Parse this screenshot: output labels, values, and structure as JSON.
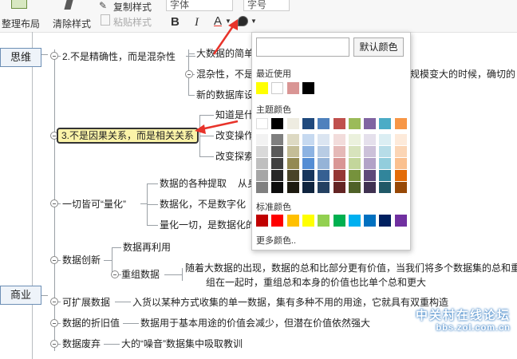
{
  "toolbar": {
    "arrange_label": "整理布局",
    "clear_label": "清除样式",
    "copy_style_label": "复制样式",
    "paste_style_label": "粘贴样式",
    "font_value": "字体",
    "font_size_value": "字号",
    "bold": "B",
    "italic": "I",
    "font_color": "A"
  },
  "mindmap": {
    "cat_thinking": "思维",
    "cat_business": "商业",
    "n_precision": "2.不是精确性，而是混杂性",
    "n_big_simple": "大数据的简单",
    "n_mixed": "混杂性，不是",
    "n_mixed_right": "规模变大的时候，确切的",
    "n_new_db": "新的数据库设",
    "n_causal": "3.不是因果关系，而是相关关系",
    "n_know": "知道是什",
    "n_change_op": "改变操作",
    "n_change_explore": "改变探索",
    "n_quantify": "一切皆可“量化”",
    "n_extract": "数据的各种提取",
    "n_extract_right": "从身",
    "n_datafy": "数据化，不是数字化",
    "n_quantify_all": "量化一切，是数据化的",
    "n_innovation": "数据创新",
    "n_reuse": "数据再利用",
    "n_recombine": "重组数据",
    "n_recombine_desc1": "随着大数据的出现，数据的总和比部分更有价值，当我们将多个数据集的总和重",
    "n_recombine_desc2": "组在一起时，重组总和本身的价值也比单个总和更大",
    "n_extensible": "可扩展数据",
    "n_extensible_desc": "入货以某种方式收集的单一数据，集有多种不用的用途，它就具有双重构造",
    "n_depreciation": "数据的折旧值",
    "n_depreciation_desc": "数据用于基本用途的价值会减少，但潜在价值依然强大",
    "n_waste": "数据废弃",
    "n_waste_desc": "大的“噪音”数据集中吸取教训"
  },
  "color_picker": {
    "hex_value": "",
    "default_button": "默认颜色",
    "recent_label": "最近使用",
    "theme_label": "主题颜色",
    "standard_label": "标准颜色",
    "more_colors": "更多颜色..",
    "recent_colors": [
      "#ffff00",
      "#ffffff",
      "#d99594",
      "#000000"
    ],
    "theme_top": [
      "#ffffff",
      "#000000",
      "#eeece1",
      "#1f497d",
      "#4f81bd",
      "#c0504d",
      "#9bbb59",
      "#8064a2",
      "#4bacc6",
      "#f79646"
    ],
    "theme_columns": [
      [
        "#f2f2f2",
        "#d9d9d9",
        "#bfbfbf",
        "#a6a6a6",
        "#808080"
      ],
      [
        "#7f7f7f",
        "#595959",
        "#3f3f3f",
        "#262626",
        "#0d0d0d"
      ],
      [
        "#ddd9c3",
        "#c4bd97",
        "#938953",
        "#494429",
        "#1d1b10"
      ],
      [
        "#c6d9f0",
        "#8db3e2",
        "#548dd4",
        "#17365d",
        "#0f243e"
      ],
      [
        "#dbe5f1",
        "#b8cce4",
        "#95b3d7",
        "#366092",
        "#244061"
      ],
      [
        "#f2dcdb",
        "#e5b9b7",
        "#d99694",
        "#953734",
        "#632423"
      ],
      [
        "#ebf1dd",
        "#d7e3bc",
        "#c3d69b",
        "#76923c",
        "#4f6128"
      ],
      [
        "#e5e0ec",
        "#ccc1d9",
        "#b2a2c7",
        "#5f497a",
        "#3f3151"
      ],
      [
        "#dbeef3",
        "#b7dde8",
        "#92cddc",
        "#31859b",
        "#205867"
      ],
      [
        "#fdeada",
        "#fbd5b5",
        "#fac08f",
        "#e36c09",
        "#974806"
      ]
    ],
    "standard_colors": [
      "#c00000",
      "#ff0000",
      "#ffc000",
      "#ffff00",
      "#92d050",
      "#00b050",
      "#00b0f0",
      "#0070c0",
      "#002060",
      "#7030a0"
    ]
  },
  "watermark": {
    "line1": "中关村在线论坛",
    "line2": "bbs.zol.com.cn"
  },
  "colors": {
    "accent_red": "#e8332a",
    "highlight_fill": "#fbf3a8",
    "category_border": "#6d8fb5"
  }
}
